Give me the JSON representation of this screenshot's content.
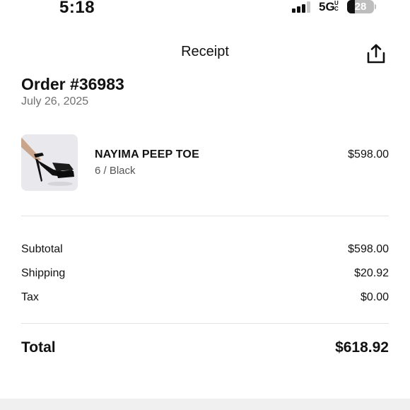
{
  "status_bar": {
    "time": "5:18",
    "network": "5G",
    "network_sub": "UC",
    "battery_level": "28",
    "battery_fraction": 0.28
  },
  "header": {
    "title": "Receipt",
    "share_icon": "share-icon"
  },
  "order": {
    "number": "Order #36983",
    "date": "July 26, 2025"
  },
  "item": {
    "name": "NAYIMA PEEP TOE",
    "variant": "6 / Black",
    "price": "$598.00",
    "image_icon": "high-heel-shoe-image"
  },
  "summary": {
    "subtotal_label": "Subtotal",
    "subtotal_value": "$598.00",
    "shipping_label": "Shipping",
    "shipping_value": "$20.92",
    "tax_label": "Tax",
    "tax_value": "$0.00",
    "total_label": "Total",
    "total_value": "$618.92"
  },
  "colors": {
    "text": "#111111",
    "muted": "#707070",
    "divider": "#e3e3e3",
    "background": "#ffffff"
  }
}
